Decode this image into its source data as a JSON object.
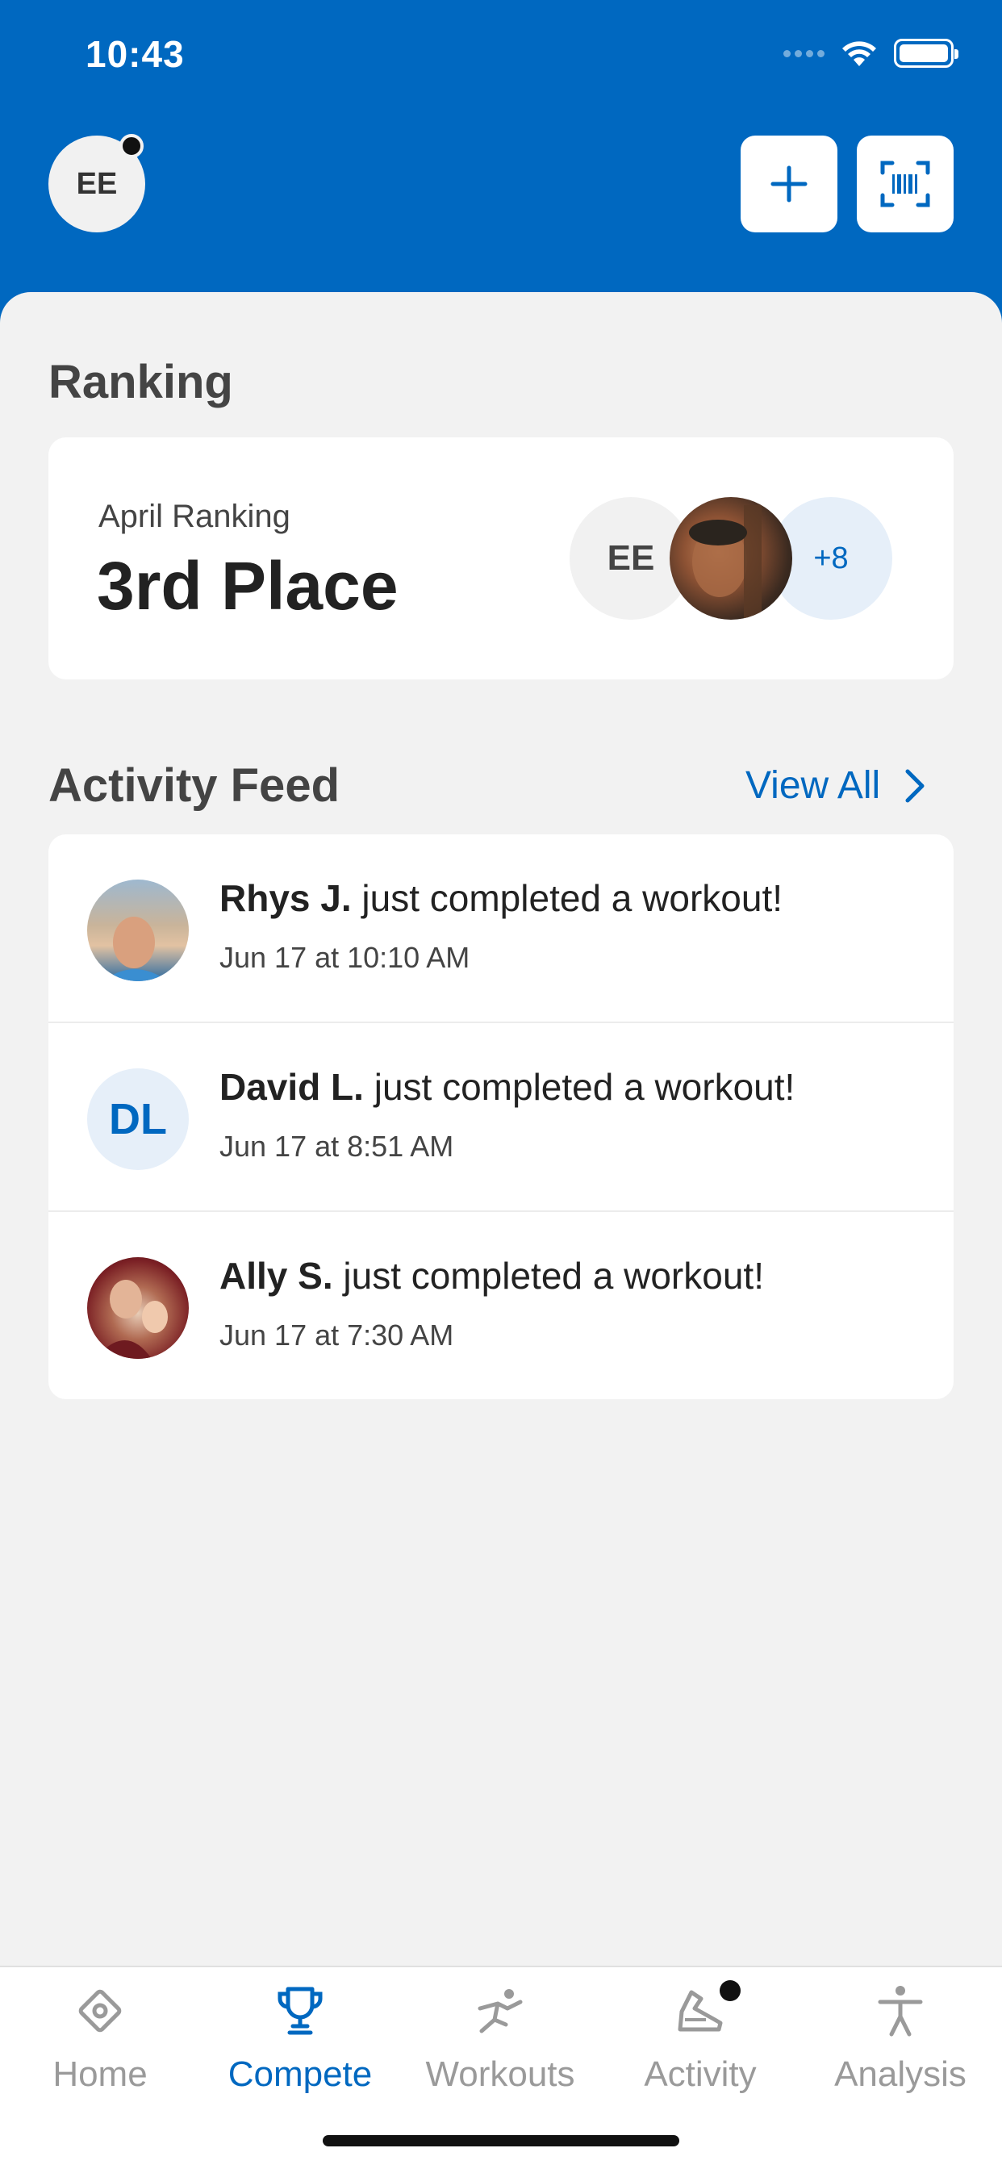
{
  "status_bar": {
    "time": "10:43"
  },
  "header": {
    "user_initials": "EE"
  },
  "ranking": {
    "section_title": "Ranking",
    "label": "April Ranking",
    "value": "3rd Place",
    "avatars": {
      "first_initials": "EE",
      "more_count": "+8"
    }
  },
  "feed": {
    "section_title": "Activity Feed",
    "view_all": "View All",
    "items": [
      {
        "name": "Rhys J.",
        "text": " just completed a workout!",
        "time": "Jun 17 at 10:10 AM",
        "initials": ""
      },
      {
        "name": "David L.",
        "text": " just completed a workout!",
        "time": "Jun 17 at 8:51 AM",
        "initials": "DL"
      },
      {
        "name": "Ally S.",
        "text": " just completed a workout!",
        "time": "Jun 17 at 7:30 AM",
        "initials": ""
      }
    ]
  },
  "tabs": [
    {
      "label": "Home",
      "icon": "home-icon"
    },
    {
      "label": "Compete",
      "icon": "trophy-icon"
    },
    {
      "label": "Workouts",
      "icon": "workouts-icon"
    },
    {
      "label": "Activity",
      "icon": "activity-icon"
    },
    {
      "label": "Analysis",
      "icon": "analysis-icon"
    }
  ],
  "active_tab": "Compete",
  "colors": {
    "brand": "#0068c0",
    "background": "#f2f2f2"
  }
}
